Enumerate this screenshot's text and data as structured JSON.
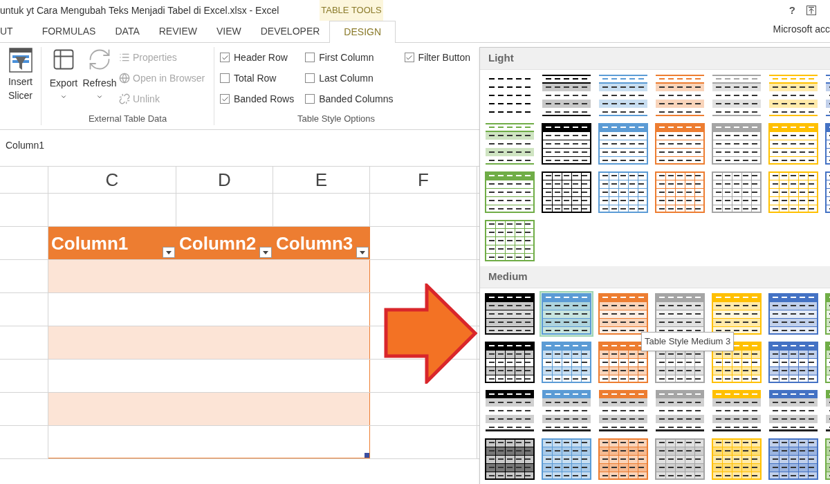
{
  "title_bar": {
    "title": "untuk yt Cara Mengubah Teks Menjadi Tabel di Excel.xlsx - Excel",
    "context_label": "TABLE TOOLS",
    "help": "?",
    "account": "Microsoft acc"
  },
  "tabs": [
    {
      "label": "UT",
      "selected": false
    },
    {
      "label": "FORMULAS",
      "selected": false
    },
    {
      "label": "DATA",
      "selected": false
    },
    {
      "label": "REVIEW",
      "selected": false
    },
    {
      "label": "VIEW",
      "selected": false
    },
    {
      "label": "DEVELOPER",
      "selected": false
    },
    {
      "label": "DESIGN",
      "selected": true
    }
  ],
  "ribbon": {
    "slicer": {
      "label": "Insert Slicer"
    },
    "external": {
      "label": "External Table Data",
      "buttons": [
        {
          "label": "Export",
          "dropdown": true
        },
        {
          "label": "Refresh",
          "dropdown": true
        }
      ],
      "items": [
        {
          "kind": "properties",
          "label": "Properties",
          "disabled": true
        },
        {
          "kind": "browser",
          "label": "Open in Browser",
          "disabled": true
        },
        {
          "kind": "unlink",
          "label": "Unlink",
          "disabled": true
        }
      ]
    },
    "style_options": {
      "label": "Table Style Options",
      "columns": [
        [
          {
            "label": "Header Row",
            "checked": true
          },
          {
            "label": "Total Row",
            "checked": false
          },
          {
            "label": "Banded Rows",
            "checked": true
          }
        ],
        [
          {
            "label": "First Column",
            "checked": false
          },
          {
            "label": "Last Column",
            "checked": false
          },
          {
            "label": "Banded Columns",
            "checked": false
          }
        ],
        [
          {
            "label": "Filter Button",
            "checked": true
          }
        ]
      ]
    }
  },
  "name_box": "Column1",
  "sheet": {
    "columns": [
      "C",
      "D",
      "E",
      "F"
    ],
    "table_headers": [
      "Column1",
      "Column2",
      "Column3"
    ],
    "rows": [
      {
        "shaded": true
      },
      {
        "shaded": false
      },
      {
        "shaded": true
      },
      {
        "shaded": false
      },
      {
        "shaded": true
      },
      {
        "shaded": false
      }
    ]
  },
  "gallery": {
    "tooltip": "Table Style Medium 3",
    "sections": [
      {
        "title": "Light",
        "rows": [
          [
            {
              "kind": "plain",
              "color": "#000000",
              "selected": false
            },
            {
              "kind": "lines",
              "color": "#000000",
              "selected": false
            },
            {
              "kind": "lines",
              "color": "#5b9bd5",
              "selected": false
            },
            {
              "kind": "lines",
              "color": "#ed7d31",
              "selected": false
            },
            {
              "kind": "lines",
              "color": "#a5a5a5",
              "selected": false
            },
            {
              "kind": "lines",
              "color": "#ffc000",
              "selected": false
            },
            {
              "kind": "lines",
              "color": "#4472c4",
              "selected": false
            }
          ],
          [
            {
              "kind": "lines",
              "color": "#70ad47",
              "selected": false
            },
            {
              "kind": "header",
              "color": "#000000",
              "selected": false
            },
            {
              "kind": "header",
              "color": "#5b9bd5",
              "selected": false
            },
            {
              "kind": "header",
              "color": "#ed7d31",
              "selected": false
            },
            {
              "kind": "header",
              "color": "#a5a5a5",
              "selected": false
            },
            {
              "kind": "header",
              "color": "#ffc000",
              "selected": false
            },
            {
              "kind": "header",
              "color": "#4472c4",
              "selected": false
            }
          ],
          [
            {
              "kind": "header",
              "color": "#70ad47",
              "selected": false
            },
            {
              "kind": "grid",
              "color": "#000000",
              "selected": false
            },
            {
              "kind": "grid",
              "color": "#5b9bd5",
              "selected": false
            },
            {
              "kind": "grid",
              "color": "#ed7d31",
              "selected": false
            },
            {
              "kind": "grid",
              "color": "#a5a5a5",
              "selected": false
            },
            {
              "kind": "grid",
              "color": "#ffc000",
              "selected": false
            },
            {
              "kind": "grid",
              "color": "#4472c4",
              "selected": false
            }
          ],
          [
            {
              "kind": "grid",
              "color": "#70ad47",
              "selected": false
            }
          ]
        ]
      },
      {
        "title": "Medium",
        "rows": [
          [
            {
              "kind": "banded",
              "color": "#000000",
              "selected": false
            },
            {
              "kind": "banded",
              "color": "#5b9bd5",
              "selected": true
            },
            {
              "kind": "banded",
              "color": "#ed7d31",
              "selected": false
            },
            {
              "kind": "banded",
              "color": "#a5a5a5",
              "selected": false
            },
            {
              "kind": "banded",
              "color": "#ffc000",
              "selected": false
            },
            {
              "kind": "banded",
              "color": "#4472c4",
              "selected": false
            },
            {
              "kind": "banded",
              "color": "#70ad47",
              "selected": false
            }
          ],
          [
            {
              "kind": "header-grid",
              "color": "#000000",
              "selected": false
            },
            {
              "kind": "header-grid",
              "color": "#5b9bd5",
              "selected": false
            },
            {
              "kind": "header-grid",
              "color": "#ed7d31",
              "selected": false
            },
            {
              "kind": "header-grid",
              "color": "#a5a5a5",
              "selected": false
            },
            {
              "kind": "header-grid",
              "color": "#ffc000",
              "selected": false
            },
            {
              "kind": "header-grid",
              "color": "#4472c4",
              "selected": false
            },
            {
              "kind": "header-grid",
              "color": "#70ad47",
              "selected": false
            }
          ],
          [
            {
              "kind": "header-rule",
              "color": "#000000",
              "selected": false
            },
            {
              "kind": "header-rule",
              "color": "#5b9bd5",
              "selected": false
            },
            {
              "kind": "header-rule",
              "color": "#ed7d31",
              "selected": false
            },
            {
              "kind": "header-rule",
              "color": "#a5a5a5",
              "selected": false
            },
            {
              "kind": "header-rule",
              "color": "#ffc000",
              "selected": false
            },
            {
              "kind": "header-rule",
              "color": "#4472c4",
              "selected": false
            },
            {
              "kind": "header-rule",
              "color": "#70ad47",
              "selected": false
            }
          ],
          [
            {
              "kind": "tint-grid",
              "color": "#000000",
              "selected": false
            },
            {
              "kind": "tint-grid",
              "color": "#5b9bd5",
              "selected": false
            },
            {
              "kind": "tint-grid",
              "color": "#ed7d31",
              "selected": false
            },
            {
              "kind": "tint-grid",
              "color": "#a5a5a5",
              "selected": false
            },
            {
              "kind": "tint-grid",
              "color": "#ffc000",
              "selected": false
            },
            {
              "kind": "tint-grid",
              "color": "#4472c4",
              "selected": false
            },
            {
              "kind": "tint-grid",
              "color": "#70ad47",
              "selected": false
            }
          ]
        ]
      }
    ]
  }
}
